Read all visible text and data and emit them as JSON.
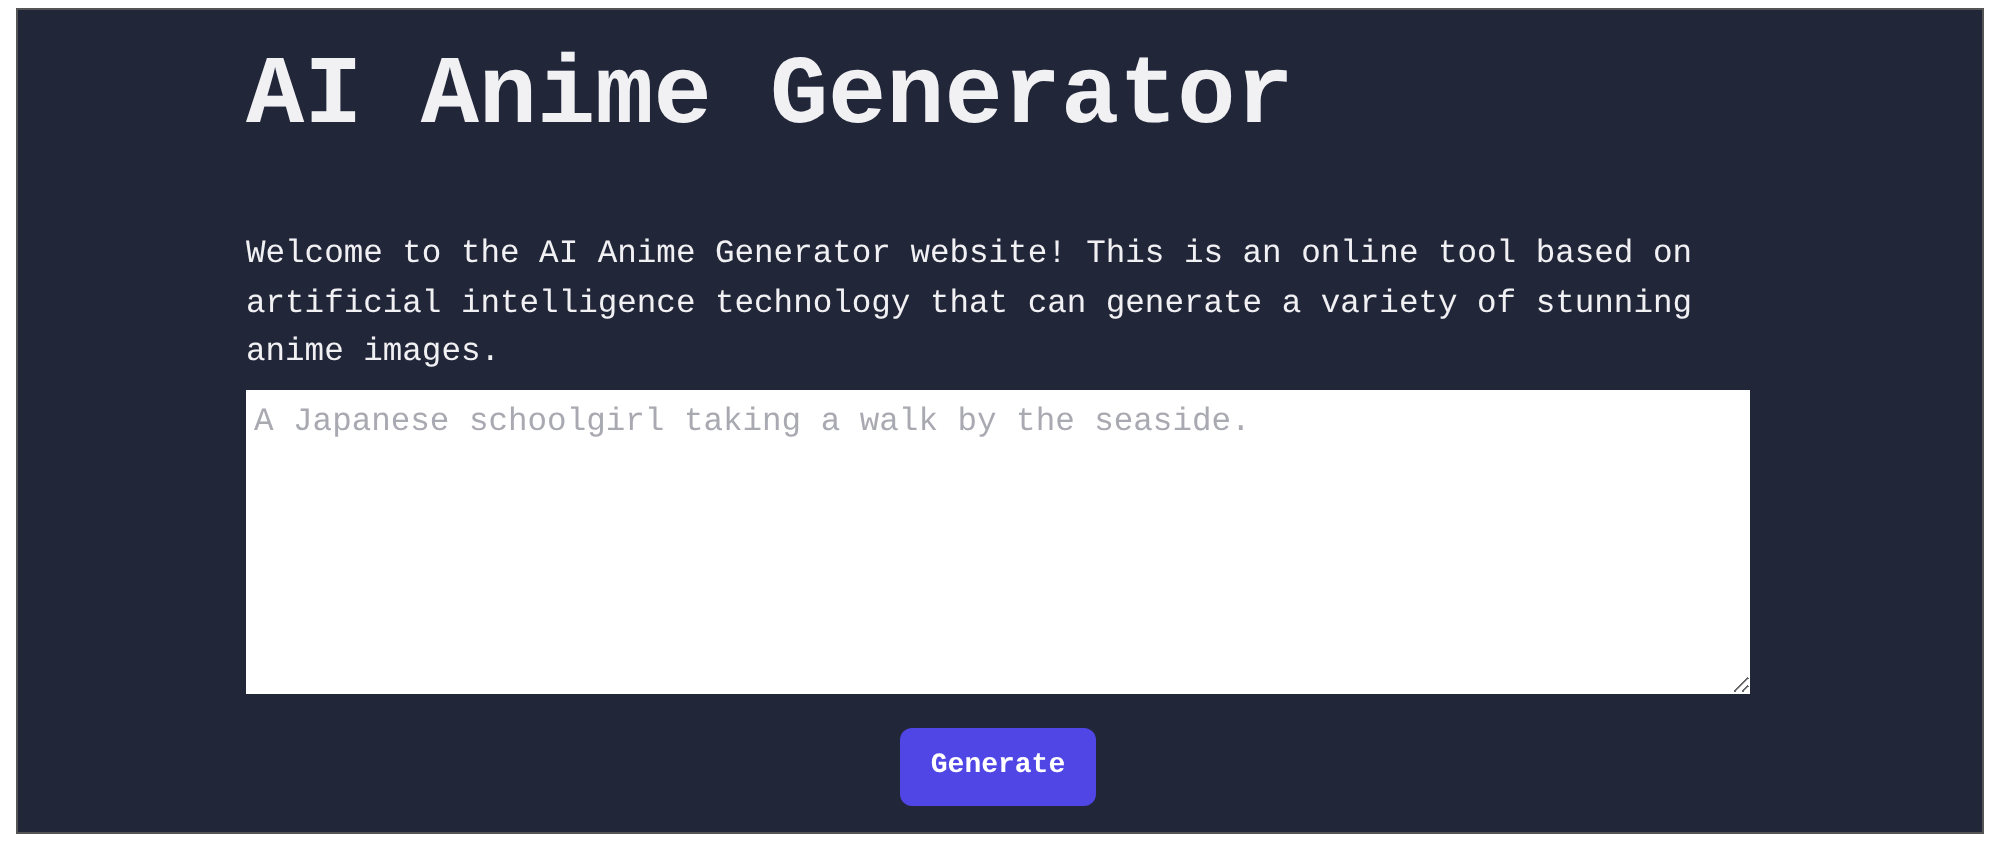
{
  "title": "AI Anime Generator",
  "intro": "Welcome to the AI Anime Generator website! This is an online tool based on artificial intelligence technology that can generate a variety of stunning anime images.",
  "prompt": {
    "placeholder": "A Japanese schoolgirl taking a walk by the seaside."
  },
  "button": "Generate"
}
